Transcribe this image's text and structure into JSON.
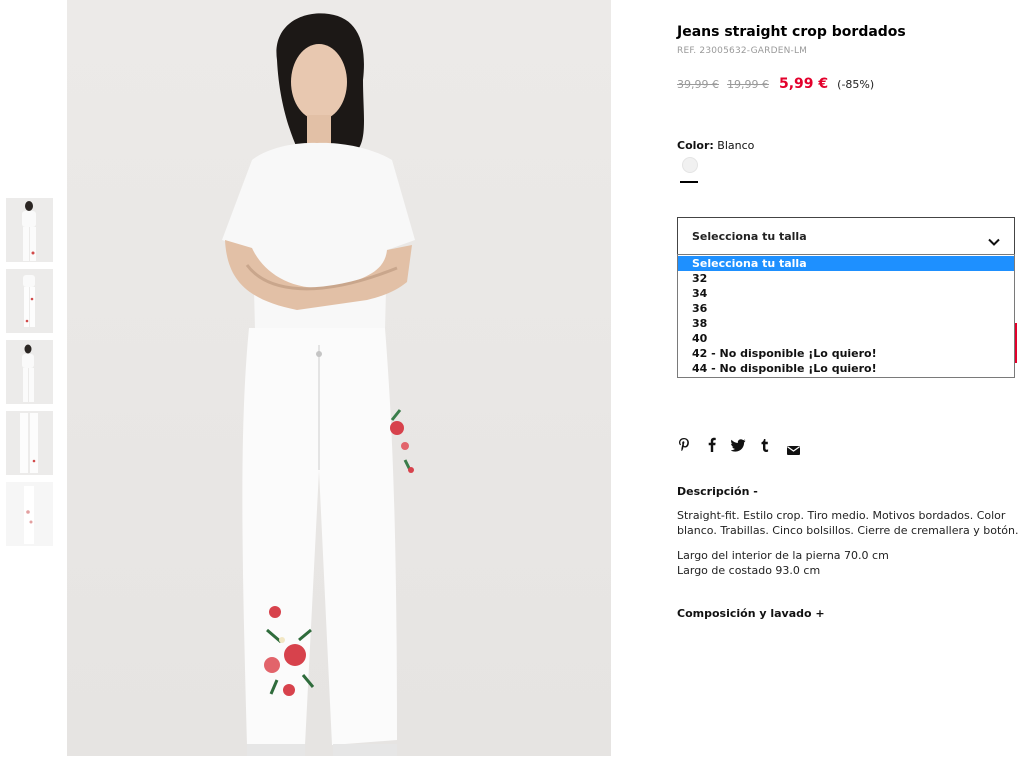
{
  "product": {
    "title": "Jeans straight crop bordados",
    "ref": "REF. 23005632-GARDEN-LM",
    "price_original": "39,99 €",
    "price_previous": "19,99 €",
    "price_current": "5,99 €",
    "discount": "(-85%)",
    "color_label": "Color:",
    "color_value": "Blanco"
  },
  "size_select": {
    "placeholder": "Selecciona tu talla",
    "options": [
      "Selecciona tu talla",
      "32",
      "34",
      "36",
      "38",
      "40",
      "42 - No disponible ¡Lo quiero!",
      "44 - No disponible ¡Lo quiero!"
    ],
    "selected_index": 0
  },
  "share_icons": [
    "pinterest-icon",
    "facebook-icon",
    "twitter-icon",
    "tumblr-icon",
    "email-icon"
  ],
  "description": {
    "heading": "Descripción -",
    "text": "Straight-fit. Estilo crop. Tiro medio. Motivos bordados. Color blanco. Trabillas. Cinco bolsillos. Cierre de cremallera y botón.",
    "measure_1": "Largo del interior de la pierna 70.0 cm",
    "measure_2": "Largo de costado 93.0 cm"
  },
  "composition": {
    "heading": "Composición y lavado +"
  },
  "colors": {
    "accent": "#e3002b",
    "highlight": "#1e90ff"
  }
}
